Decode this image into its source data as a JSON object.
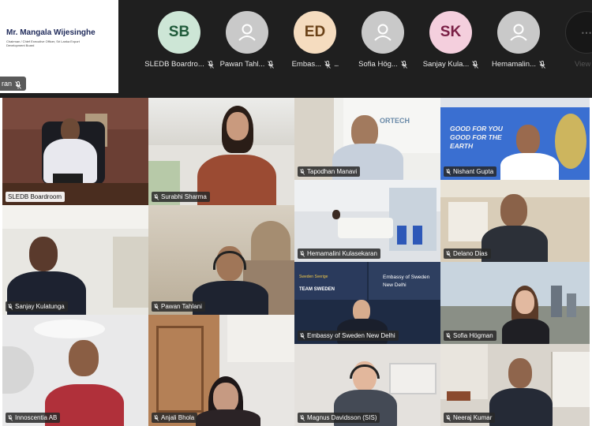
{
  "presenter": {
    "slide_title": "Mr. Mangala Wijesinghe",
    "slide_subtitle": "Chairman / Chief Executive Officer, Sri Lanka Export Development Board",
    "name_tag": "ran"
  },
  "attendees": [
    {
      "initials": "SB",
      "name": "SLEDB Boardro...",
      "color": "sb",
      "muted": true
    },
    {
      "initials": "",
      "name": "Pawan Tahl...",
      "color": "gray",
      "muted": true
    },
    {
      "initials": "ED",
      "name": "Embas...",
      "color": "ed",
      "muted": true,
      "more": "..."
    },
    {
      "initials": "",
      "name": "Sofia Hög...",
      "color": "gray",
      "muted": true
    },
    {
      "initials": "SK",
      "name": "Sanjay Kula...",
      "color": "sk",
      "muted": true
    },
    {
      "initials": "",
      "name": "Hemamalin...",
      "color": "gray",
      "muted": true
    },
    {
      "initials": "",
      "name": "View",
      "color": "view",
      "muted": false
    }
  ],
  "tiles": {
    "sledb": {
      "label": "SLEDB Boardroom"
    },
    "surabhi": {
      "label": "Surabhi Sharma"
    },
    "tapodhan": {
      "label": "Tapodhan Manavi",
      "backdrop_text": "ORTECH"
    },
    "nishant": {
      "label": "Nishant Gupta",
      "backdrop_text": "GOOD FOR YOU GOOD FOR THE EARTH"
    },
    "hemamalini": {
      "label": "Hemamalini Kulasekaran"
    },
    "delano": {
      "label": "Delano Dias"
    },
    "sanjay": {
      "label": "Sanjay Kulatunga"
    },
    "pawan": {
      "label": "Pawan Tahlani"
    },
    "embassy": {
      "label": "Embassy of Sweden New Delhi",
      "banner_left_top": "Sweden Sverige",
      "banner_left_bottom": "TEAM SWEDEN",
      "banner_right_top": "Embassy of Sweden",
      "banner_right_bottom": "New Delhi"
    },
    "sofia": {
      "label": "Sofia Högman"
    },
    "innoscentia": {
      "label": "Innoscentia AB"
    },
    "anjali": {
      "label": "Anjali Bhola"
    },
    "magnus": {
      "label": "Magnus Davidsson (SIS)"
    },
    "neeraj": {
      "label": "Neeraj Kumar"
    }
  },
  "colors": {
    "background": "#1f1f1f",
    "label_bg": "#282828"
  }
}
